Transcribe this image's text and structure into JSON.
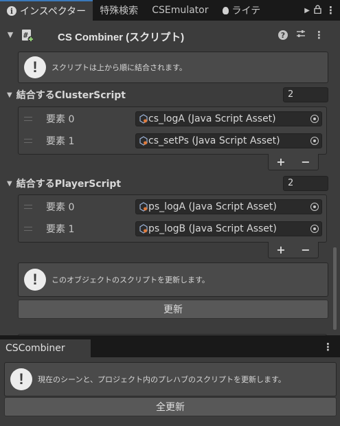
{
  "tabs": {
    "inspector": "インスペクター",
    "special_search": "特殊検索",
    "cs_emulator": "CSEmulator",
    "lighting": "ライテ"
  },
  "component": {
    "title": "CS Combiner (スクリプト)",
    "help_top": "スクリプトは上から順に結合されます。"
  },
  "cluster_scripts": {
    "label": "結合するClusterScript",
    "count": "2",
    "items": [
      {
        "label": "要素 0",
        "value": "cs_logA (Java Script Asset)"
      },
      {
        "label": "要素 1",
        "value": "cs_setPs (Java Script Asset)"
      }
    ]
  },
  "player_scripts": {
    "label": "結合するPlayerScript",
    "count": "2",
    "items": [
      {
        "label": "要素 0",
        "value": "ps_logA (Java Script Asset)"
      },
      {
        "label": "要素 1",
        "value": "ps_logB (Java Script Asset)"
      }
    ]
  },
  "list_controls": {
    "plus": "+",
    "minus": "−"
  },
  "update_section": {
    "help": "このオブジェクトのスクリプトを更新します。",
    "button": "更新"
  },
  "cscombiner_panel": {
    "tab": "CSCombiner",
    "help": "現在のシーンと、プロジェクト内のプレハブのスクリプトを更新します。",
    "button": "全更新"
  },
  "icons": {
    "info": "i",
    "help": "?",
    "kebab": "⋮",
    "bang": "!"
  },
  "colors": {
    "panel_bg": "#3c3c3c",
    "field_bg": "#2a2a2a",
    "tab_accent": "#3a79bb",
    "asset_icon": "#e07a3a"
  }
}
